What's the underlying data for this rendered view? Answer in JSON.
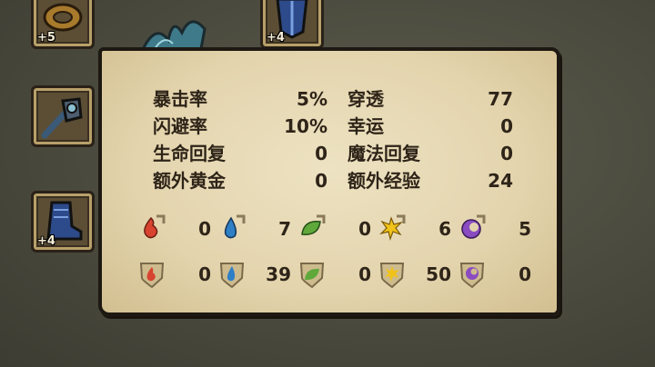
{
  "slots": [
    {
      "level": "+5",
      "icon": "ring-icon"
    },
    {
      "level": "+4",
      "icon": "armor-icon"
    },
    {
      "level": "",
      "icon": "club-weapon-icon"
    },
    {
      "level": "+4",
      "icon": "boot-icon"
    }
  ],
  "stats": [
    {
      "label": "暴击率",
      "value": "5%",
      "label2": "穿透",
      "value2": "77"
    },
    {
      "label": "闪避率",
      "value": "10%",
      "label2": "幸运",
      "value2": "0"
    },
    {
      "label": "生命回复",
      "value": "0",
      "label2": "魔法回复",
      "value2": "0"
    },
    {
      "label": "额外黄金",
      "value": "0",
      "label2": "额外经验",
      "value2": "24"
    }
  ],
  "elements_attack": [
    {
      "icon": "fire-icon",
      "value": "0",
      "color": "#d8432f"
    },
    {
      "icon": "water-icon",
      "value": "7",
      "color": "#2f7fc4"
    },
    {
      "icon": "leaf-icon",
      "value": "0",
      "color": "#5fa83a"
    },
    {
      "icon": "lightning-icon",
      "value": "6",
      "color": "#f0c21a"
    },
    {
      "icon": "dark-moon-icon",
      "value": "5",
      "color": "#8a4cc0"
    }
  ],
  "elements_defense": [
    {
      "icon": "fire-shield-icon",
      "value": "0",
      "color": "#d8432f"
    },
    {
      "icon": "water-shield-icon",
      "value": "39",
      "color": "#2f7fc4"
    },
    {
      "icon": "leaf-shield-icon",
      "value": "0",
      "color": "#5fa83a"
    },
    {
      "icon": "lightning-shield-icon",
      "value": "50",
      "color": "#f0c21a"
    },
    {
      "icon": "dark-shield-icon",
      "value": "0",
      "color": "#8a4cc0"
    }
  ]
}
